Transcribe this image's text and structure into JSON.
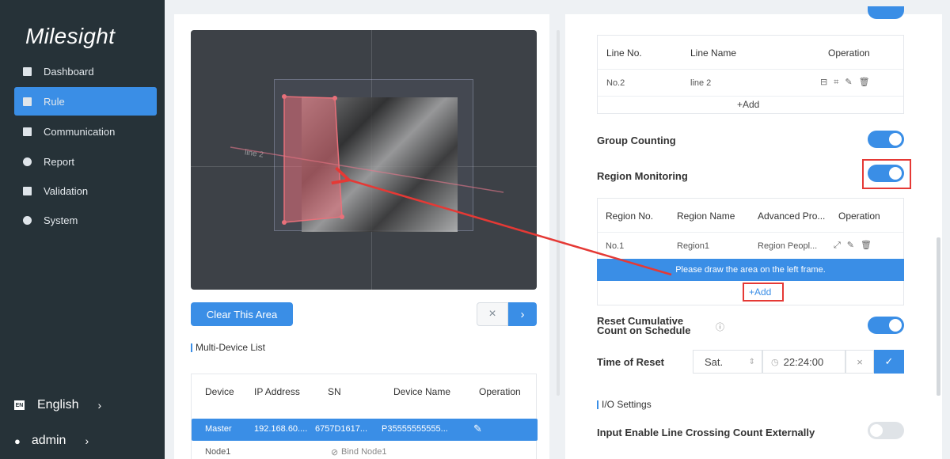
{
  "sidebar": {
    "logo": "Milesight",
    "items": [
      {
        "label": "Dashboard",
        "icon": "bar-chart-icon"
      },
      {
        "label": "Rule",
        "icon": "list-icon"
      },
      {
        "label": "Communication",
        "icon": "message-icon"
      },
      {
        "label": "Report",
        "icon": "pie-chart-icon"
      },
      {
        "label": "Validation",
        "icon": "play-icon"
      },
      {
        "label": "System",
        "icon": "gear-icon"
      }
    ],
    "active": "Rule",
    "language": "English",
    "user": "admin"
  },
  "left": {
    "video_line_label": "line 2",
    "clear_button": "Clear This Area",
    "close_symbol": "×",
    "next_symbol": "›",
    "multi_device_title": "Multi-Device List",
    "device_table": {
      "columns": [
        "Device",
        "IP Address",
        "SN",
        "Device Name",
        "Operation"
      ],
      "rows": [
        {
          "device": "Master",
          "ip": "192.168.60....",
          "sn": "6757D1617...",
          "name": "P35555555555..."
        },
        {
          "device": "Node1",
          "bind": "Bind Node1"
        }
      ]
    }
  },
  "right": {
    "line_table": {
      "columns": [
        "Line No.",
        "Line Name",
        "Operation"
      ],
      "rows": [
        {
          "no": "No.2",
          "name": "line 2"
        }
      ],
      "add": "+Add"
    },
    "group_counting": {
      "label": "Group Counting",
      "on": true
    },
    "region_monitoring": {
      "label": "Region Monitoring",
      "on": true
    },
    "region_table": {
      "columns": [
        "Region No.",
        "Region Name",
        "Advanced Pro...",
        "Operation"
      ],
      "rows": [
        {
          "no": "No.1",
          "name": "Region1",
          "adv": "Region Peopl..."
        }
      ],
      "hint": "Please draw the area on the left frame.",
      "add": "+Add"
    },
    "reset_schedule": {
      "label_line1": "Reset Cumulative",
      "label_line2": "Count on Schedule",
      "on": true
    },
    "time_of_reset": {
      "label": "Time of Reset",
      "day": "Sat.",
      "time": "22:24:00"
    },
    "io_title": "I/O Settings",
    "input_enable": {
      "label": "Input Enable Line Crossing Count Externally",
      "on": false
    }
  },
  "colors": {
    "accent": "#3a8ee6",
    "sidebar": "#263238",
    "highlight": "#e53935"
  }
}
